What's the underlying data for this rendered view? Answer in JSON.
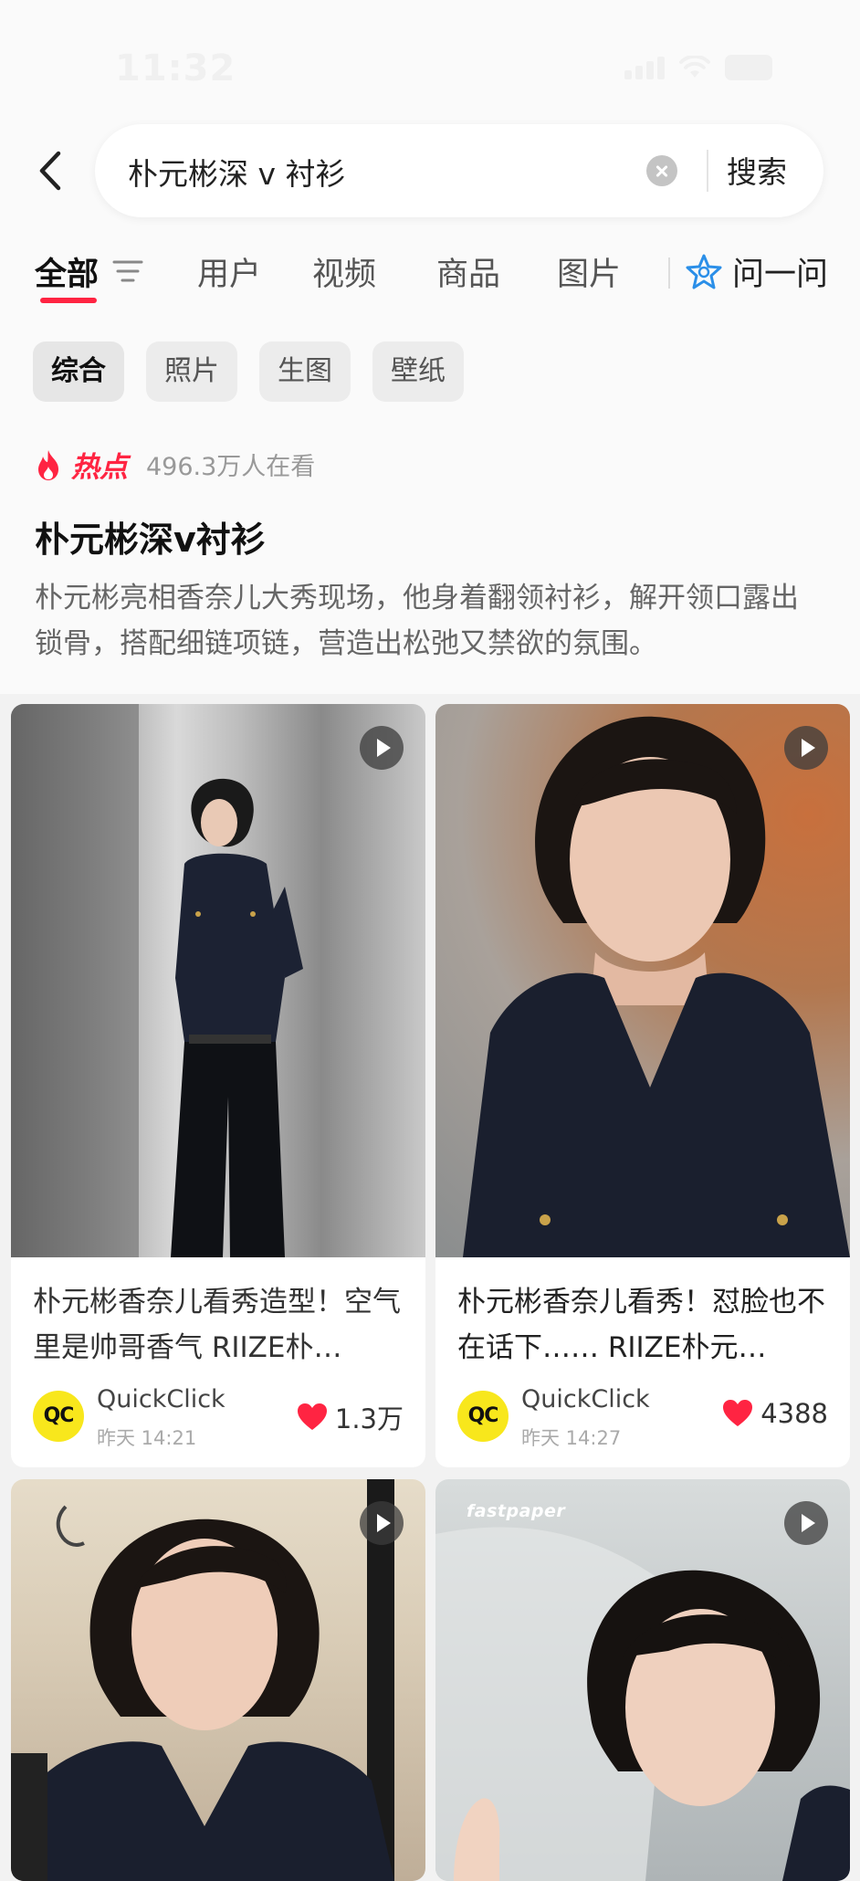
{
  "status_bar": {
    "time": "11:32"
  },
  "search": {
    "query": "朴元彬深 v 衬衫",
    "button_label": "搜索"
  },
  "tabs": {
    "items": [
      {
        "label": "全部",
        "active": true
      },
      {
        "label": "用户",
        "active": false
      },
      {
        "label": "视频",
        "active": false
      },
      {
        "label": "商品",
        "active": false
      },
      {
        "label": "图片",
        "active": false
      }
    ],
    "ask_label": "问一问"
  },
  "chips": [
    {
      "label": "综合",
      "active": true
    },
    {
      "label": "照片",
      "active": false
    },
    {
      "label": "生图",
      "active": false
    },
    {
      "label": "壁纸",
      "active": false
    }
  ],
  "hot": {
    "label": "热点",
    "viewers": "496.3万人在看",
    "title": "朴元彬深v衬衫",
    "description": "朴元彬亮相香奈儿大秀现场，他身着翻领衬衫，解开领口露出锁骨，搭配细链项链，营造出松弛又禁欲的氛围。"
  },
  "cards": [
    {
      "title": "朴元彬香奈儿看秀造型！空气里是帅哥香气 RIIZE朴…",
      "author": "QuickClick",
      "avatar_text": "QC",
      "time": "昨天 14:21",
      "likes": "1.3万",
      "is_video": true
    },
    {
      "title": "朴元彬香奈儿看秀！怼脸也不在话下…… RIIZE朴元…",
      "author": "QuickClick",
      "avatar_text": "QC",
      "time": "昨天 14:27",
      "likes": "4388",
      "is_video": true
    },
    {
      "title": "",
      "is_video": true
    },
    {
      "watermark": "fastpaper",
      "title": "",
      "is_video": true
    }
  ],
  "colors": {
    "accent": "#ff2442",
    "avatar_bg": "#f8e71c",
    "ask_icon": "#2b8fe8"
  },
  "icons": {
    "back": "chevron-left-icon",
    "clear": "clear-circle-icon",
    "filter": "filter-lines-icon",
    "ask": "sparkle-star-icon",
    "hot": "flame-icon",
    "play": "play-icon",
    "like": "heart-icon"
  }
}
